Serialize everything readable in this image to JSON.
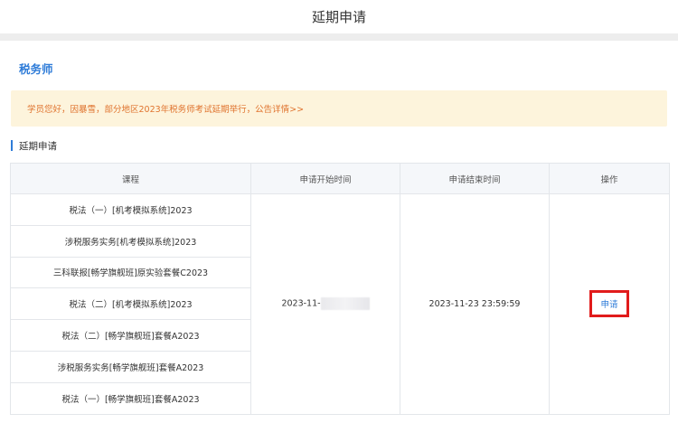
{
  "header": {
    "title": "延期申请"
  },
  "section": {
    "title": "税务师"
  },
  "notice": {
    "text": "学员您好，因暴雪，部分地区2023年税务师考试延期举行，公告详情>>"
  },
  "subsection": {
    "title": "延期申请"
  },
  "table": {
    "columns": [
      "课程",
      "申请开始时间",
      "申请结束时间",
      "操作"
    ],
    "courses": [
      "税法（一）[机考模拟系统]2023",
      "涉税服务实务[机考模拟系统]2023",
      "三科联报[畅学旗舰班]原实验套餐C2023",
      "税法（二）[机考模拟系统]2023",
      "税法（二）[畅学旗舰班]套餐A2023",
      "涉税服务实务[畅学旗舰班]套餐A2023",
      "税法（一）[畅学旗舰班]套餐A2023"
    ],
    "start_time": "2023-11-",
    "end_time": "2023-11-23 23:59:59",
    "action_label": "申请"
  },
  "colors": {
    "accent": "#2f7cd8",
    "notice_bg": "#fdf4dc",
    "notice_text": "#e0742f",
    "highlight_box": "#e11b1b"
  }
}
